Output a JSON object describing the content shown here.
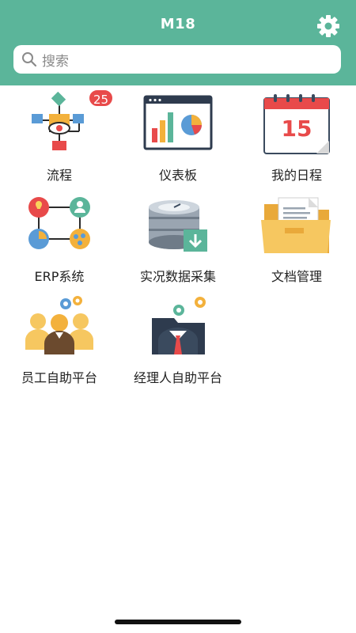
{
  "header": {
    "title": "M18"
  },
  "search": {
    "placeholder": "搜索"
  },
  "tiles": [
    {
      "label": "流程",
      "badge": "25"
    },
    {
      "label": "仪表板"
    },
    {
      "label": "我的日程",
      "calendar_day": "15"
    },
    {
      "label": "ERP系统"
    },
    {
      "label": "实况数据采集"
    },
    {
      "label": "文档管理"
    },
    {
      "label": "员工自助平台"
    },
    {
      "label": "经理人自助平台"
    }
  ],
  "colors": {
    "header": "#5bb59a",
    "badge": "#e84a4a"
  }
}
